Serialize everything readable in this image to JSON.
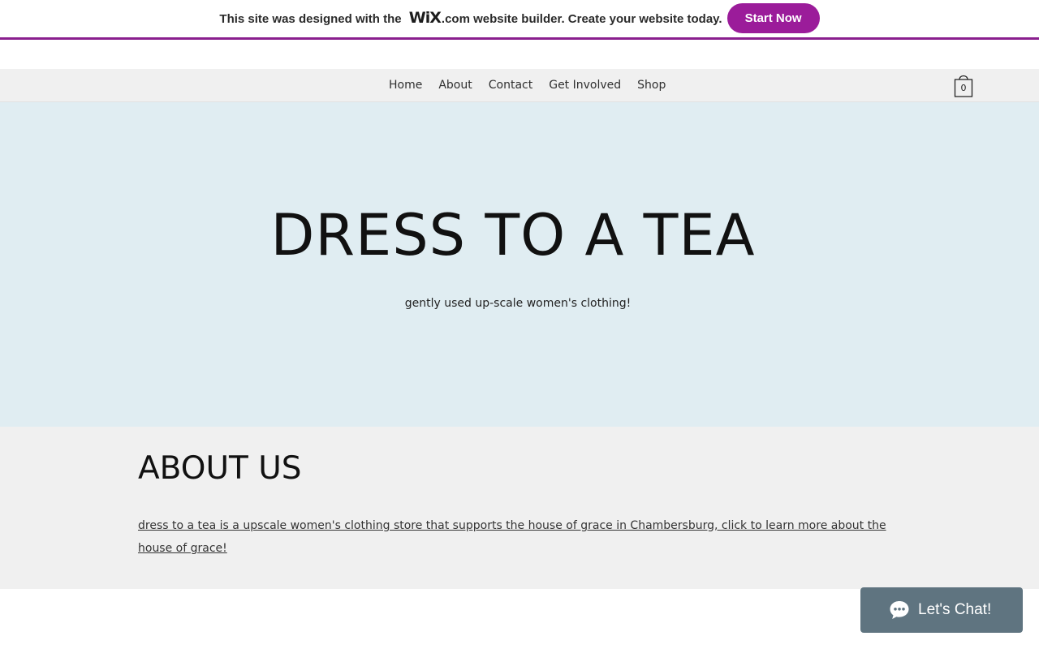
{
  "banner": {
    "text_before": "This site was designed with the ",
    "logo_text": "WiX",
    "text_after": ".com website builder. Create your website today.",
    "button_label": "Start Now",
    "accent_color": "#9b1c9a"
  },
  "nav": {
    "items": [
      {
        "label": "Home"
      },
      {
        "label": "About"
      },
      {
        "label": "Contact"
      },
      {
        "label": "Get Involved"
      },
      {
        "label": "Shop"
      }
    ],
    "cart": {
      "icon": "shopping-bag-icon",
      "count": "0"
    }
  },
  "hero": {
    "title": "DRESS TO A TEA",
    "subtitle": "gently used up-scale women's clothing!",
    "background_color": "#e0edf2"
  },
  "about": {
    "heading": "ABOUT US",
    "link_text": "dress to a tea is a upscale women's clothing store that supports the house of grace in Chambersburg, click to learn more about the house of grace! "
  },
  "chat": {
    "icon": "chat-bubble-icon",
    "label": "Let's Chat!",
    "background_color": "#5f7480"
  }
}
